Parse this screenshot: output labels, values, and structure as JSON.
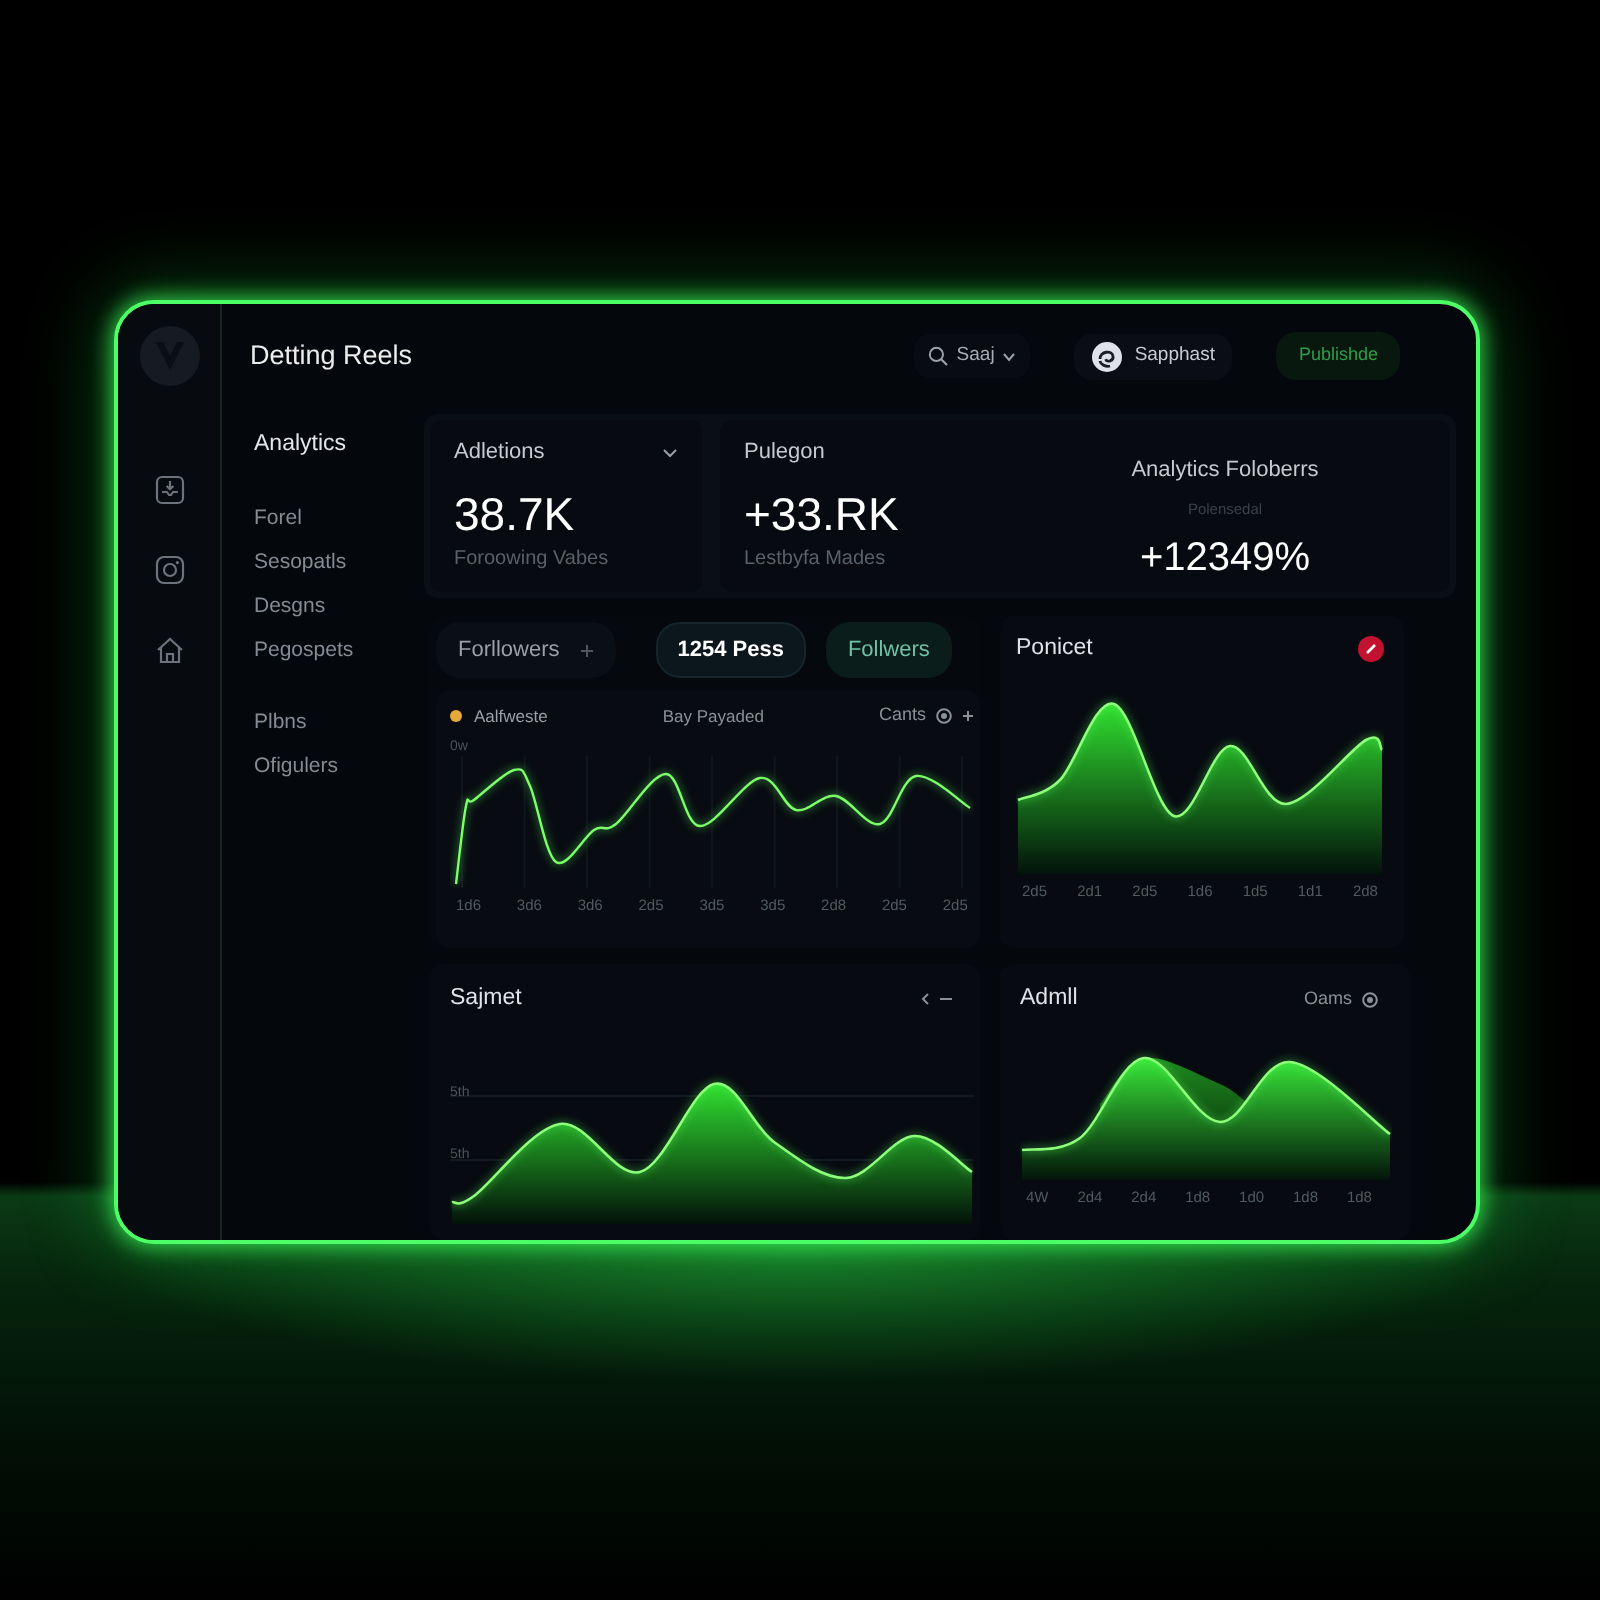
{
  "header": {
    "title": "Detting Reels",
    "search": "Saaj",
    "user": "Sapphast",
    "publish_button": "Publishde"
  },
  "sidebar": {
    "heading": "Analytics",
    "groups": [
      {
        "items": [
          "Forel",
          "Sesopatls",
          "Desgns",
          "Pegospets"
        ]
      },
      {
        "items": [
          "Plbns",
          "Ofigulers"
        ]
      }
    ]
  },
  "stat_cards": [
    {
      "menu": true,
      "metrics": [
        {
          "kind": "standard",
          "label": "Adletions",
          "value": "38.7K",
          "caption": "Foroowing Vabes"
        }
      ]
    },
    {
      "menu": false,
      "metrics": [
        {
          "kind": "standard",
          "label": "Pulegon",
          "value": "+33.RK",
          "caption": "Lestbyfa Mades"
        },
        {
          "kind": "centered",
          "label": "Analytics Foloberrs",
          "caption": "Polensedal",
          "value": "+12349%"
        }
      ]
    }
  ],
  "charts": [
    {
      "kind": "line",
      "tabs": [
        {
          "kind": "dropdown",
          "label": "Forllowers",
          "selected": false
        },
        {
          "kind": "pill",
          "label": "1254 Pess",
          "selected": true
        },
        {
          "kind": "accent",
          "label": "Follwers",
          "selected": false
        }
      ],
      "legend": "Aalfweste",
      "subtitle": "Bay Payaded",
      "control": "Cants",
      "y_labels": [
        "0w"
      ],
      "x_labels": [
        "1d6",
        "3d6",
        "3d6",
        "2d5",
        "3d5",
        "3d5",
        "2d8",
        "2d5",
        "2d5"
      ],
      "alert": false,
      "actions": false
    },
    {
      "kind": "area",
      "title": "Ponicet",
      "x_labels": [
        "2d5",
        "2d1",
        "2d5",
        "1d6",
        "1d5",
        "1d1",
        "2d8"
      ],
      "alert": true,
      "actions": false
    },
    {
      "kind": "area",
      "title": "Sajmet",
      "y_labels": [
        "5th",
        "5th"
      ],
      "alert": false,
      "actions": true
    },
    {
      "kind": "double_area",
      "title": "Admll",
      "control": "Oams",
      "x_labels": [
        "4W",
        "2d4",
        "2d4",
        "1d8",
        "1d0",
        "1d8",
        "1d8"
      ],
      "alert": false,
      "actions": false
    }
  ]
}
